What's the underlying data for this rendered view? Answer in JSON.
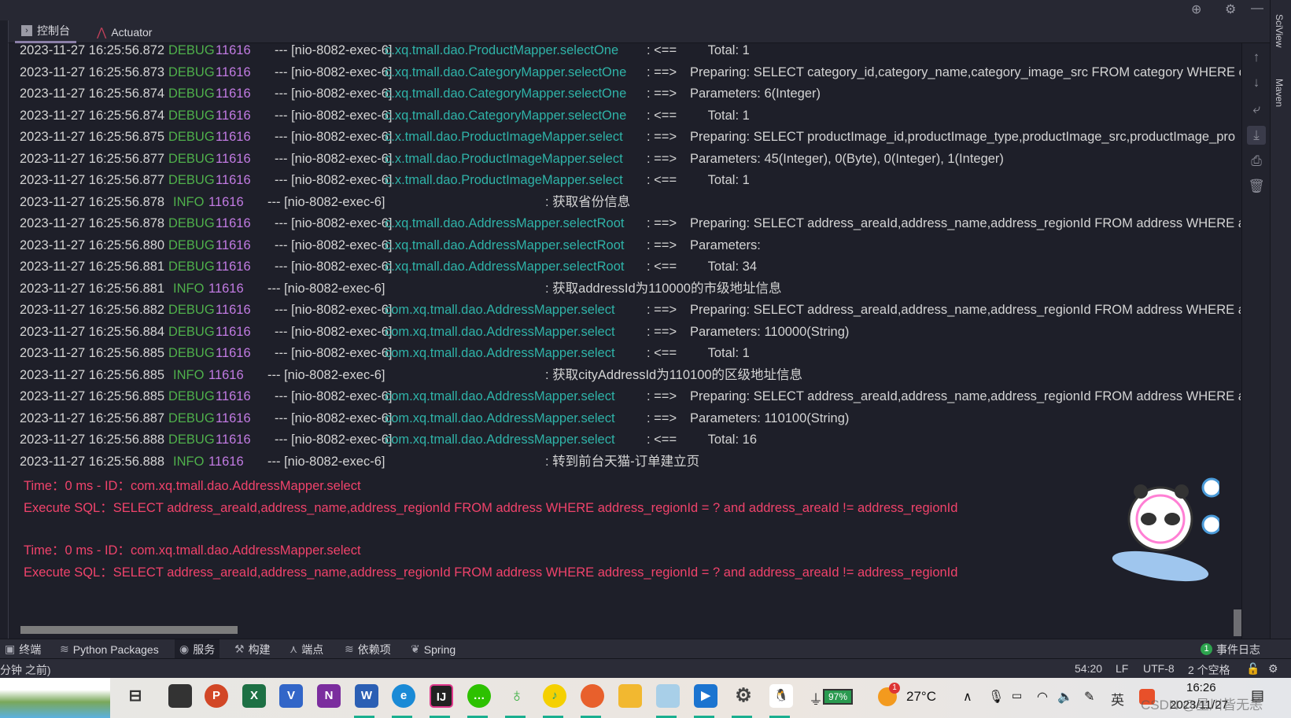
{
  "tabs": [
    {
      "label": "控制台",
      "icon": "console-icon"
    },
    {
      "label": "Actuator",
      "icon": "actuator-icon"
    }
  ],
  "log": [
    {
      "ts": "2023-11-27 16:25:56.872",
      "level": "DEBUG",
      "pid": "11616",
      "thread": "--- [nio-8082-exec-6]",
      "logger": "c.xq.tmall.dao.ProductMapper.selectOne",
      "arrow": ": <==",
      "msg": "     Total: 1"
    },
    {
      "ts": "2023-11-27 16:25:56.873",
      "level": "DEBUG",
      "pid": "11616",
      "thread": "--- [nio-8082-exec-6]",
      "logger": "c.xq.tmall.dao.CategoryMapper.selectOne",
      "arrow": ": ==>",
      "msg": "Preparing: SELECT category_id,category_name,category_image_src FROM category WHERE ca"
    },
    {
      "ts": "2023-11-27 16:25:56.874",
      "level": "DEBUG",
      "pid": "11616",
      "thread": "--- [nio-8082-exec-6]",
      "logger": "c.xq.tmall.dao.CategoryMapper.selectOne",
      "arrow": ": ==>",
      "msg": "Parameters: 6(Integer)"
    },
    {
      "ts": "2023-11-27 16:25:56.874",
      "level": "DEBUG",
      "pid": "11616",
      "thread": "--- [nio-8082-exec-6]",
      "logger": "c.xq.tmall.dao.CategoryMapper.selectOne",
      "arrow": ": <==",
      "msg": "     Total: 1"
    },
    {
      "ts": "2023-11-27 16:25:56.875",
      "level": "DEBUG",
      "pid": "11616",
      "thread": "--- [nio-8082-exec-6]",
      "logger": "c.x.tmall.dao.ProductImageMapper.select",
      "arrow": ": ==>",
      "msg": "Preparing: SELECT productImage_id,productImage_type,productImage_src,productImage_pro"
    },
    {
      "ts": "2023-11-27 16:25:56.877",
      "level": "DEBUG",
      "pid": "11616",
      "thread": "--- [nio-8082-exec-6]",
      "logger": "c.x.tmall.dao.ProductImageMapper.select",
      "arrow": ": ==>",
      "msg": "Parameters: 45(Integer), 0(Byte), 0(Integer), 1(Integer)"
    },
    {
      "ts": "2023-11-27 16:25:56.877",
      "level": "DEBUG",
      "pid": "11616",
      "thread": "--- [nio-8082-exec-6]",
      "logger": "c.x.tmall.dao.ProductImageMapper.select",
      "arrow": ": <==",
      "msg": "     Total: 1"
    },
    {
      "ts": "2023-11-27 16:25:56.878",
      "level": "INFO",
      "pid": "11616",
      "thread": "--- [nio-8082-exec-6]",
      "logger": "",
      "arrow": "",
      "msg": ": 获取省份信息"
    },
    {
      "ts": "2023-11-27 16:25:56.878",
      "level": "DEBUG",
      "pid": "11616",
      "thread": "--- [nio-8082-exec-6]",
      "logger": "c.xq.tmall.dao.AddressMapper.selectRoot",
      "arrow": ": ==>",
      "msg": "Preparing: SELECT address_areaId,address_name,address_regionId FROM address WHERE add"
    },
    {
      "ts": "2023-11-27 16:25:56.880",
      "level": "DEBUG",
      "pid": "11616",
      "thread": "--- [nio-8082-exec-6]",
      "logger": "c.xq.tmall.dao.AddressMapper.selectRoot",
      "arrow": ": ==>",
      "msg": "Parameters: "
    },
    {
      "ts": "2023-11-27 16:25:56.881",
      "level": "DEBUG",
      "pid": "11616",
      "thread": "--- [nio-8082-exec-6]",
      "logger": "c.xq.tmall.dao.AddressMapper.selectRoot",
      "arrow": ": <==",
      "msg": "     Total: 34"
    },
    {
      "ts": "2023-11-27 16:25:56.881",
      "level": "INFO",
      "pid": "11616",
      "thread": "--- [nio-8082-exec-6]",
      "logger": "",
      "arrow": "",
      "msg": ": 获取addressId为110000的市级地址信息"
    },
    {
      "ts": "2023-11-27 16:25:56.882",
      "level": "DEBUG",
      "pid": "11616",
      "thread": "--- [nio-8082-exec-6]",
      "logger": "com.xq.tmall.dao.AddressMapper.select",
      "arrow": ": ==>",
      "msg": "Preparing: SELECT address_areaId,address_name,address_regionId FROM address WHERE addr"
    },
    {
      "ts": "2023-11-27 16:25:56.884",
      "level": "DEBUG",
      "pid": "11616",
      "thread": "--- [nio-8082-exec-6]",
      "logger": "com.xq.tmall.dao.AddressMapper.select",
      "arrow": ": ==>",
      "msg": "Parameters: 110000(String)"
    },
    {
      "ts": "2023-11-27 16:25:56.885",
      "level": "DEBUG",
      "pid": "11616",
      "thread": "--- [nio-8082-exec-6]",
      "logger": "com.xq.tmall.dao.AddressMapper.select",
      "arrow": ": <==",
      "msg": "     Total: 1"
    },
    {
      "ts": "2023-11-27 16:25:56.885",
      "level": "INFO",
      "pid": "11616",
      "thread": "--- [nio-8082-exec-6]",
      "logger": "",
      "arrow": "",
      "msg": ": 获取cityAddressId为110100的区级地址信息"
    },
    {
      "ts": "2023-11-27 16:25:56.885",
      "level": "DEBUG",
      "pid": "11616",
      "thread": "--- [nio-8082-exec-6]",
      "logger": "com.xq.tmall.dao.AddressMapper.select",
      "arrow": ": ==>",
      "msg": "Preparing: SELECT address_areaId,address_name,address_regionId FROM address WHERE addr"
    },
    {
      "ts": "2023-11-27 16:25:56.887",
      "level": "DEBUG",
      "pid": "11616",
      "thread": "--- [nio-8082-exec-6]",
      "logger": "com.xq.tmall.dao.AddressMapper.select",
      "arrow": ": ==>",
      "msg": "Parameters: 110100(String)"
    },
    {
      "ts": "2023-11-27 16:25:56.888",
      "level": "DEBUG",
      "pid": "11616",
      "thread": "--- [nio-8082-exec-6]",
      "logger": "com.xq.tmall.dao.AddressMapper.select",
      "arrow": ": <==",
      "msg": "     Total: 16"
    },
    {
      "ts": "2023-11-27 16:25:56.888",
      "level": "INFO",
      "pid": "11616",
      "thread": "--- [nio-8082-exec-6]",
      "logger": "",
      "arrow": "",
      "msg": ": 转到前台天猫-订单建立页"
    }
  ],
  "sql": [
    {
      "time": "Time：0 ms - ID：com.xq.tmall.dao.AddressMapper.select",
      "exec": "Execute SQL：SELECT address_areaId,address_name,address_regionId FROM address WHERE address_regionId = ? and address_areaId != address_regionId"
    },
    {
      "time": "Time：0 ms - ID：com.xq.tmall.dao.AddressMapper.select",
      "exec": "Execute SQL：SELECT address_areaId,address_name,address_regionId FROM address WHERE address_regionId = ? and address_areaId != address_regionId"
    }
  ],
  "right_sidebar": [
    "SciView",
    "Maven"
  ],
  "tool_windows": [
    {
      "label": "终端",
      "icon": "terminal-icon"
    },
    {
      "label": "Python Packages",
      "icon": "layers-icon"
    },
    {
      "label": "服务",
      "icon": "services-icon",
      "selected": true
    },
    {
      "label": "构建",
      "icon": "hammer-icon"
    },
    {
      "label": "端点",
      "icon": "endpoints-icon"
    },
    {
      "label": "依赖项",
      "icon": "layers-icon"
    },
    {
      "label": "Spring",
      "icon": "spring-leaf-icon"
    }
  ],
  "event_log": {
    "count": "1",
    "label": "事件日志"
  },
  "status": {
    "left": "分钟 之前)",
    "position": "54:20",
    "line_sep": "LF",
    "encoding": "UTF-8",
    "indent": "2 个空格"
  },
  "taskbar": {
    "battery": "97%",
    "weather_badge": "1",
    "temperature": "27°C",
    "ime": "英",
    "time": "16:26",
    "date": "2023/11/27",
    "watermark": "CSDN @星川皆无恙"
  },
  "colors": {
    "debug": "#4fb04b",
    "pid": "#c27be3",
    "logger": "#2fb3a8",
    "sql": "#f0436b",
    "background": "#1e1f29"
  }
}
